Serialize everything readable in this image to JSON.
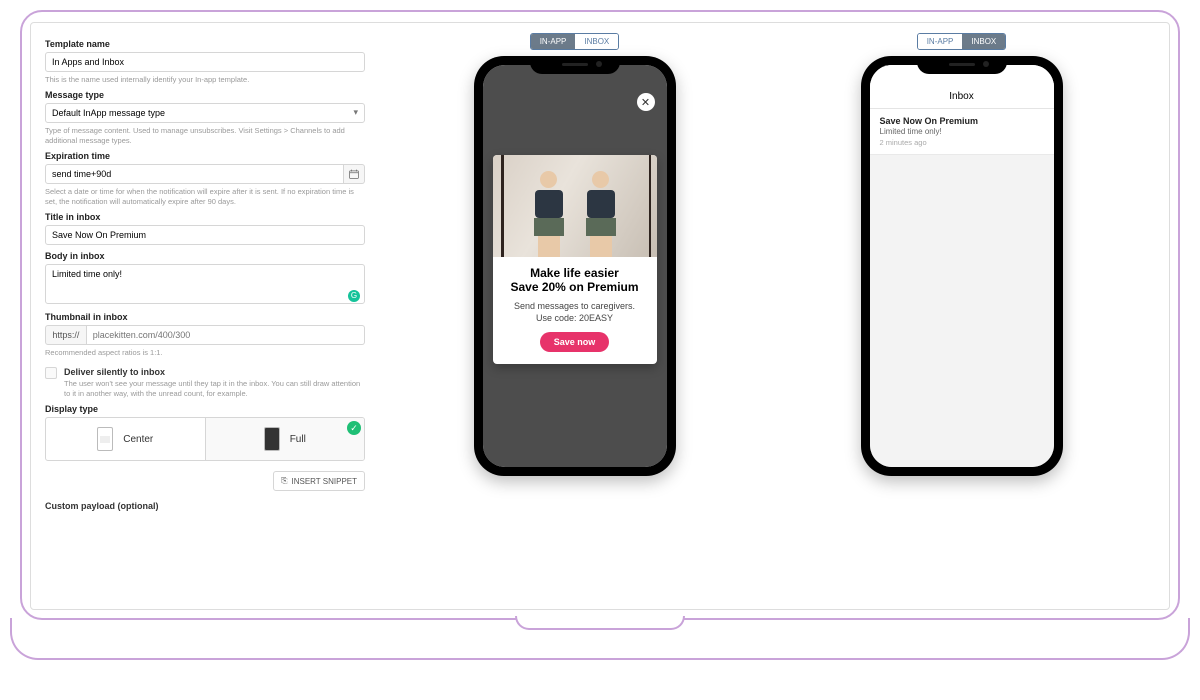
{
  "form": {
    "template_name": {
      "label": "Template name",
      "value": "In Apps and Inbox",
      "help": "This is the name used internally identify your In-app template."
    },
    "message_type": {
      "label": "Message type",
      "value": "Default InApp message type",
      "help": "Type of message content. Used to manage unsubscribes. Visit Settings > Channels to add additional message types."
    },
    "expiration": {
      "label": "Expiration time",
      "value": "send time+90d",
      "help": "Select a date or time for when the notification will expire after it is sent. If no expiration time is set, the notification will automatically expire after 90 days."
    },
    "title": {
      "label": "Title in inbox",
      "value": "Save Now On Premium"
    },
    "body": {
      "label": "Body in inbox",
      "value": "Limited time only!"
    },
    "thumb": {
      "label": "Thumbnail in inbox",
      "protocol": "https://",
      "placeholder": "placekitten.com/400/300",
      "help": "Recommended aspect ratios is 1:1."
    },
    "silent": {
      "title": "Deliver silently to inbox",
      "help": "The user won't see your message until they tap it in the inbox. You can still draw attention to it in another way, with the unread count, for example."
    },
    "display": {
      "label": "Display type",
      "opt1": "Center",
      "opt2": "Full"
    },
    "snippet": "INSERT SNIPPET",
    "payload": "Custom payload (optional)"
  },
  "preview": {
    "tabs": {
      "inapp": "IN-APP",
      "inbox": "INBOX"
    },
    "card": {
      "h1": "Make life easier",
      "h2": "Save 20% on Premium",
      "t1": "Send messages to caregivers.",
      "t2": "Use code: 20EASY",
      "cta": "Save now"
    },
    "inbox": {
      "header": "Inbox",
      "title": "Save Now On Premium",
      "sub": "Limited time only!",
      "time": "2 minutes ago"
    }
  }
}
